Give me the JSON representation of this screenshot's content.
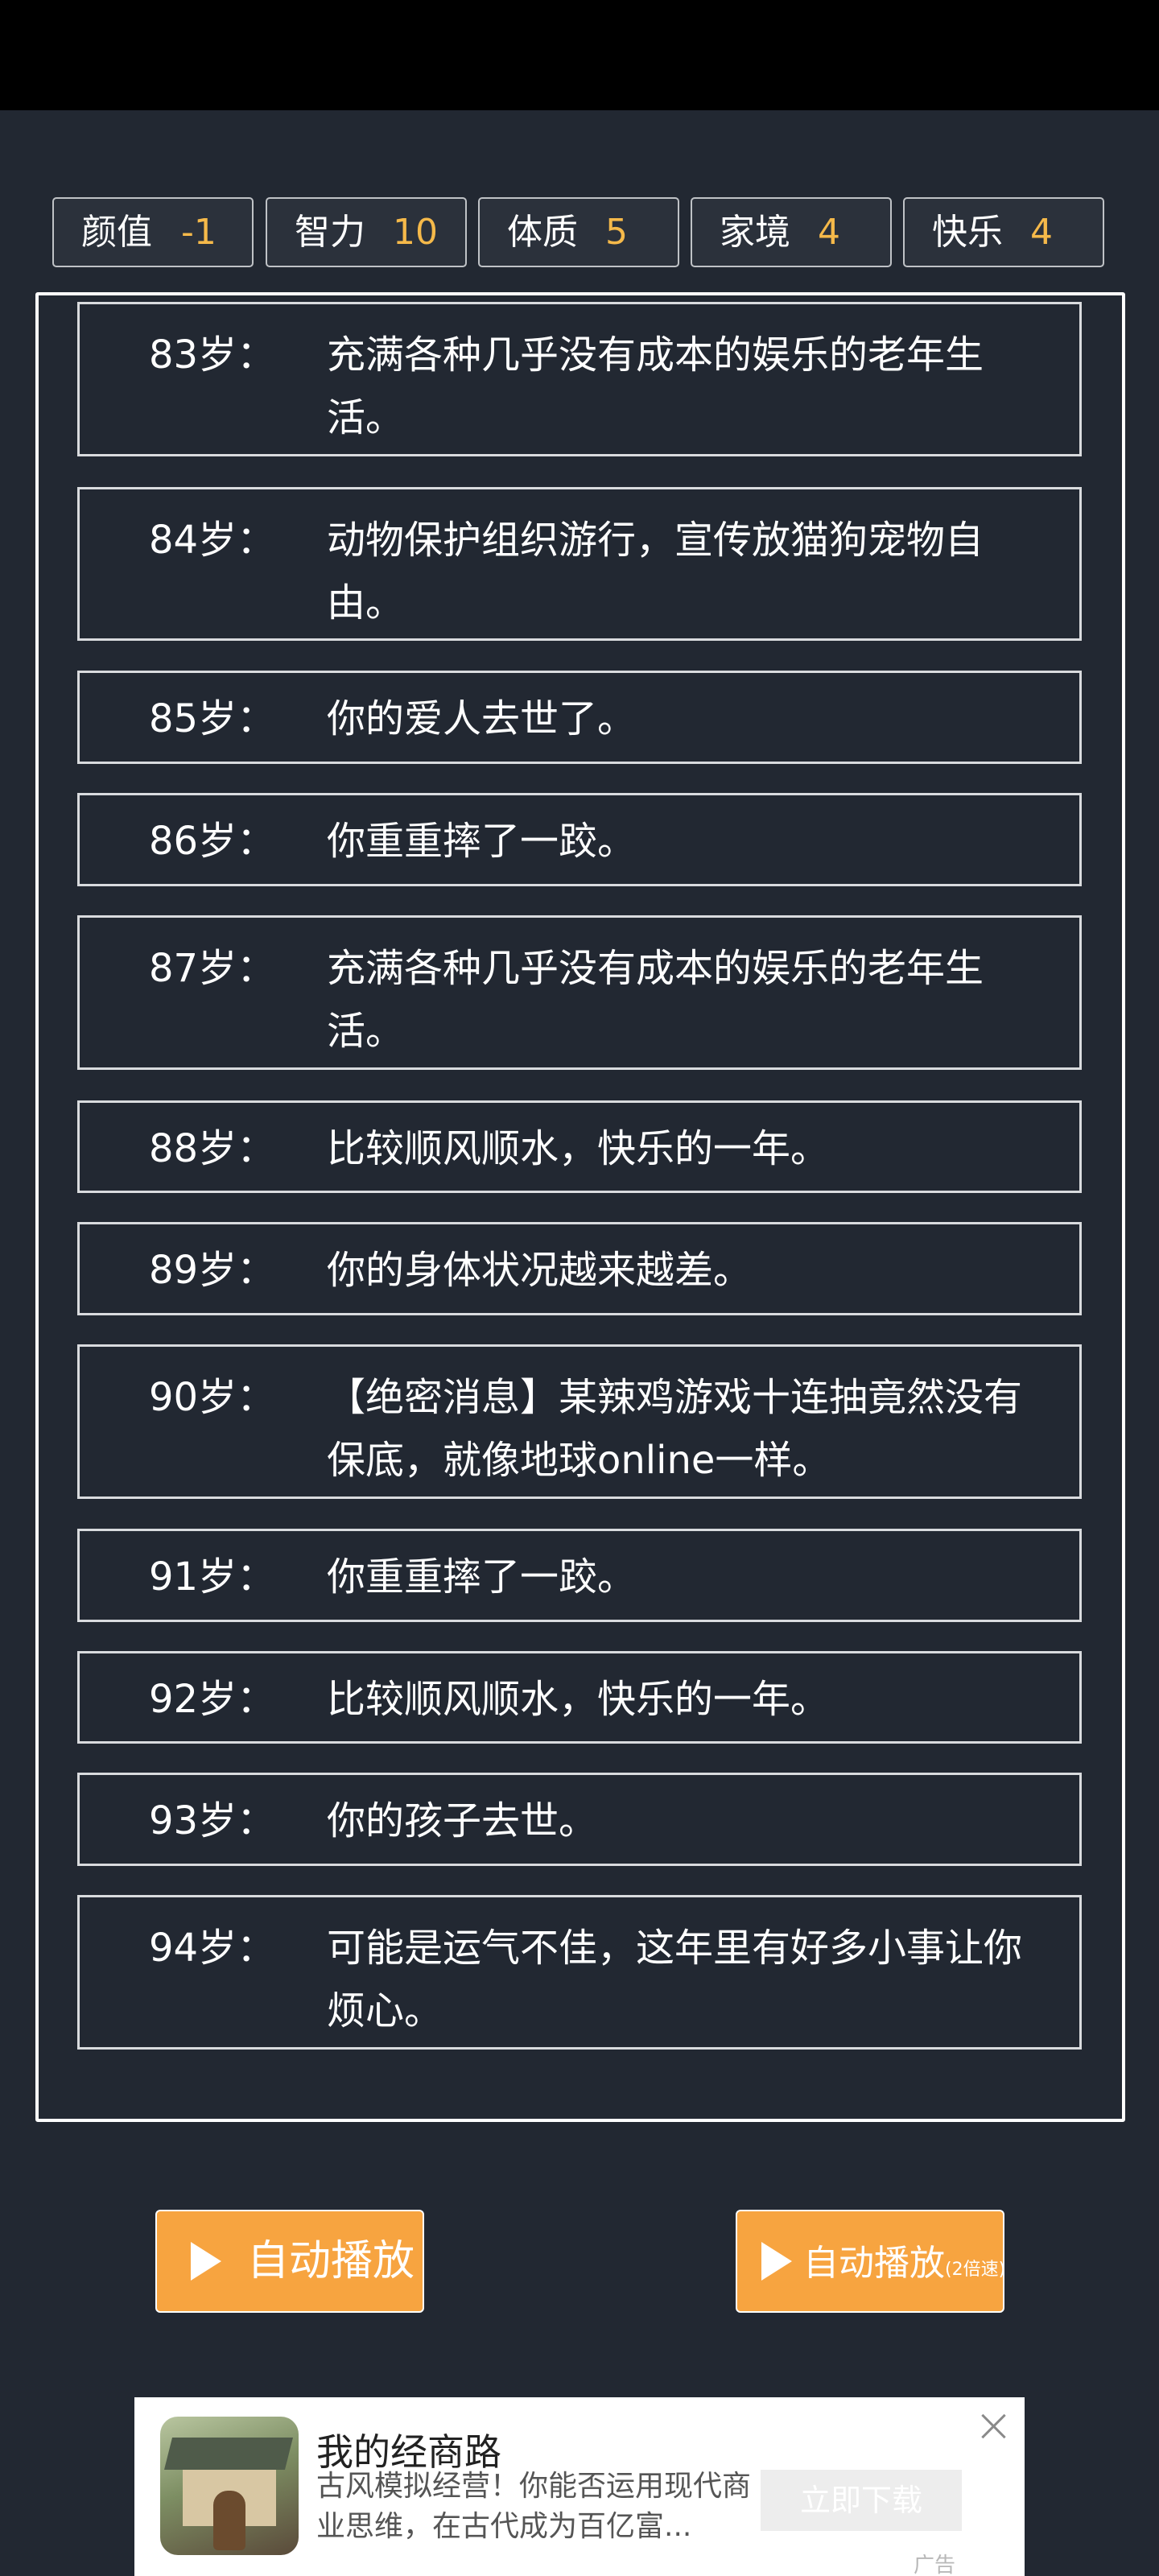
{
  "stats": [
    {
      "label": "颜值",
      "value": "-1"
    },
    {
      "label": "智力",
      "value": "10"
    },
    {
      "label": "体质",
      "value": "5"
    },
    {
      "label": "家境",
      "value": "4"
    },
    {
      "label": "快乐",
      "value": "4"
    }
  ],
  "log": [
    {
      "age": "83岁：",
      "text": "充满各种几乎没有成本的娱乐的老年生活。"
    },
    {
      "age": "84岁：",
      "text": "动物保护组织游行，宣传放猫狗宠物自由。"
    },
    {
      "age": "85岁：",
      "text": "你的爱人去世了。"
    },
    {
      "age": "86岁：",
      "text": "你重重摔了一跤。"
    },
    {
      "age": "87岁：",
      "text": "充满各种几乎没有成本的娱乐的老年生活。"
    },
    {
      "age": "88岁：",
      "text": "比较顺风顺水，快乐的一年。"
    },
    {
      "age": "89岁：",
      "text": "你的身体状况越来越差。"
    },
    {
      "age": "90岁：",
      "text": "【绝密消息】某辣鸡游戏十连抽竟然没有保底，就像地球online一样。"
    },
    {
      "age": "91岁：",
      "text": "你重重摔了一跤。"
    },
    {
      "age": "92岁：",
      "text": "比较顺风顺水，快乐的一年。"
    },
    {
      "age": "93岁：",
      "text": "你的孩子去世。"
    },
    {
      "age": "94岁：",
      "text": "可能是运气不佳，这年里有好多小事让你烦心。"
    }
  ],
  "buttons": {
    "auto_play": "自动播放",
    "auto_play_fast": "自动播放",
    "auto_play_fast_note": "(2倍速)"
  },
  "ad": {
    "title": "我的经商路",
    "description": "古风模拟经营！你能否运用现代商业思维，在古代成为百亿富...",
    "cta": "立即下载",
    "tag": "广告"
  },
  "colors": {
    "background": "#222832",
    "stat_value": "#f5b94a",
    "button": "#f7a440"
  }
}
